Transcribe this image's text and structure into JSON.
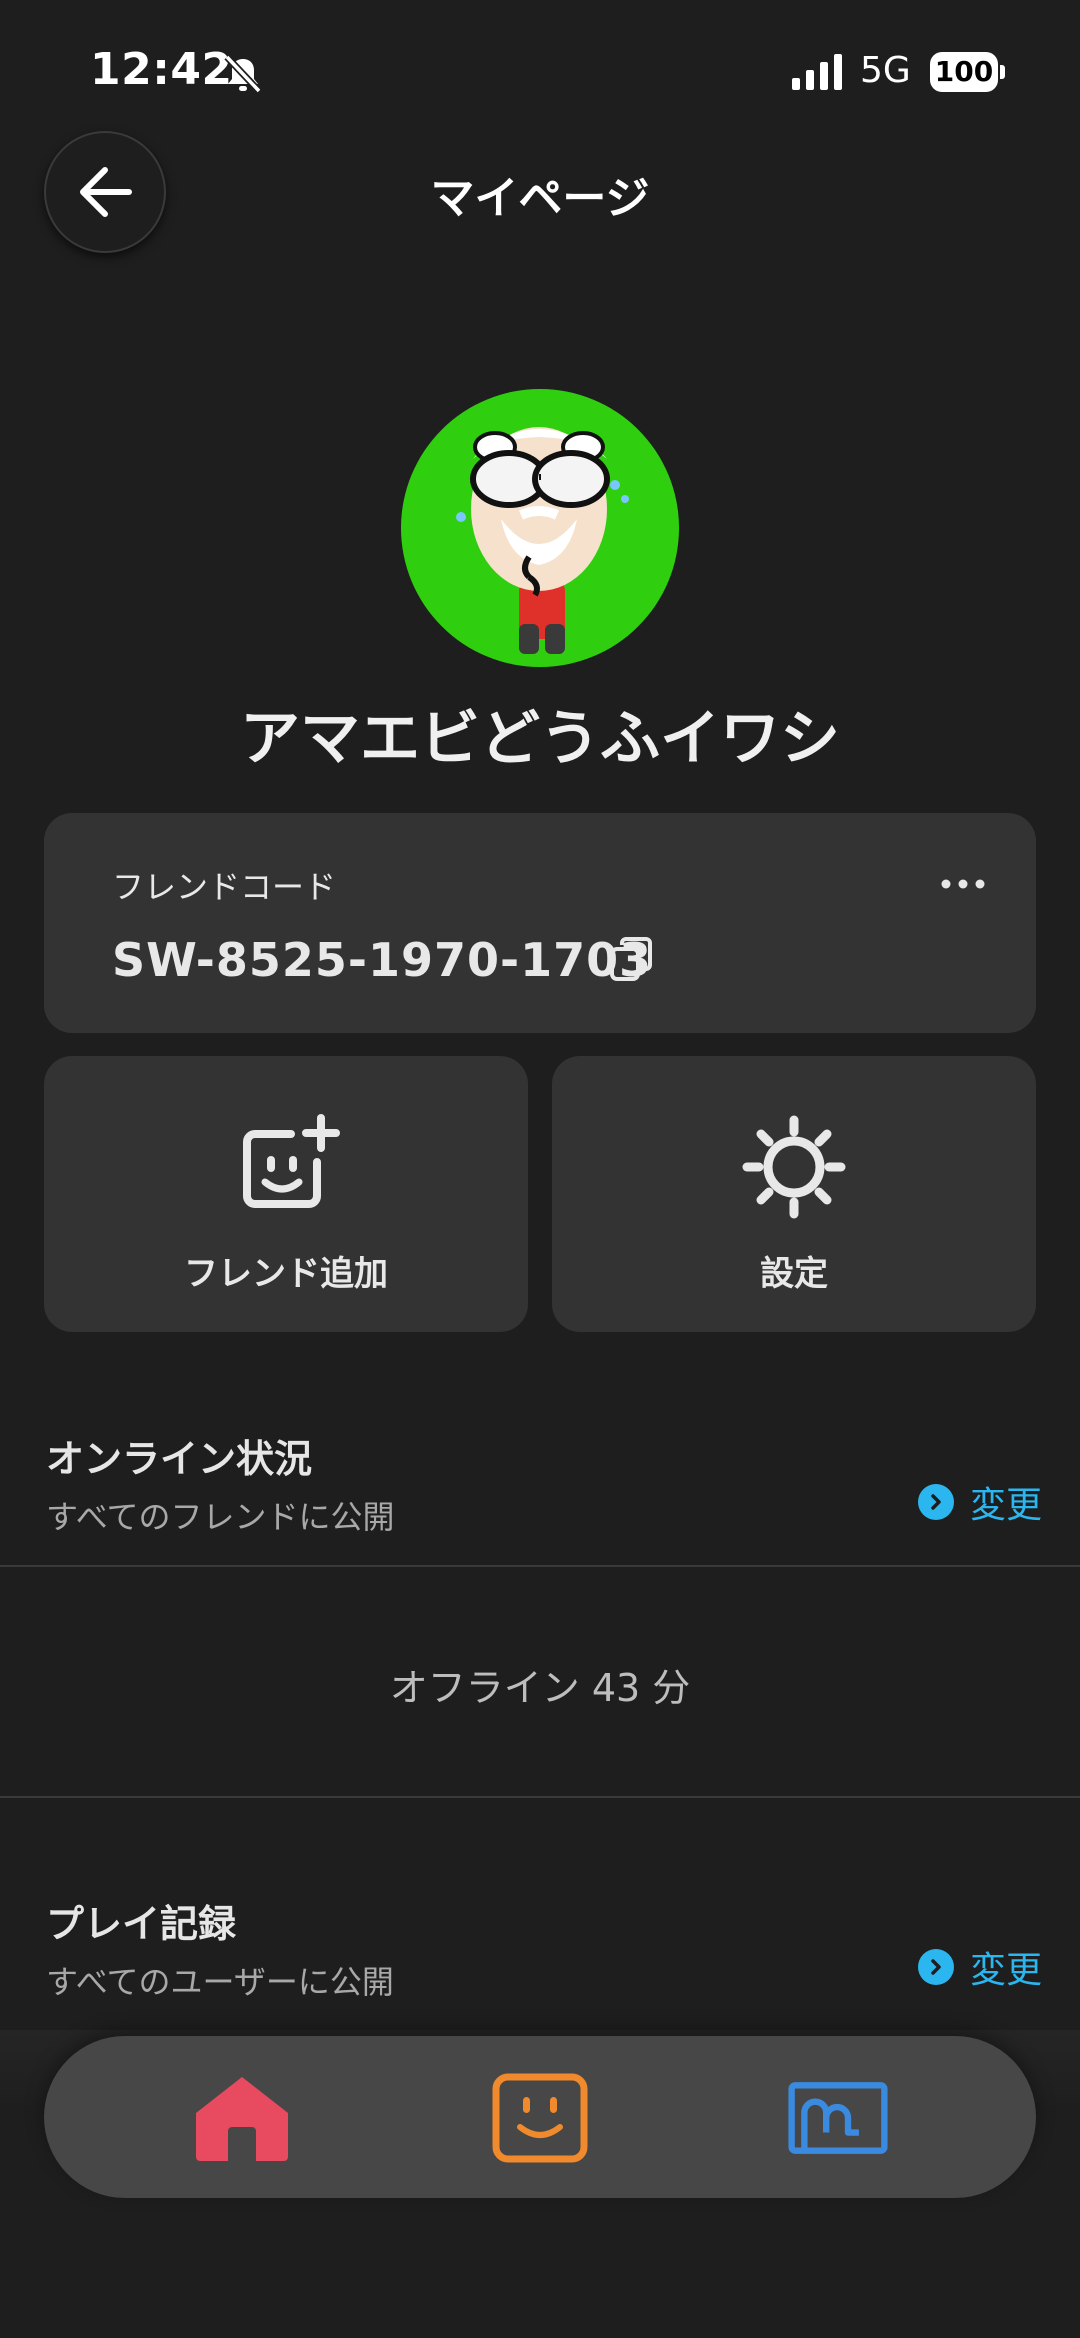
{
  "status_bar": {
    "time": "12:42",
    "network": "5G",
    "battery": "100"
  },
  "header": {
    "title": "マイページ"
  },
  "profile": {
    "username": "アマエビどうふイワシ"
  },
  "friend_code": {
    "label": "フレンドコード",
    "value": "SW-8525-1970-1703"
  },
  "actions": [
    {
      "label": "フレンド追加",
      "icon": "add-friend-icon"
    },
    {
      "label": "設定",
      "icon": "gear-icon"
    }
  ],
  "online_status": {
    "title": "オンライン状況",
    "subtitle": "すべてのフレンドに公開",
    "change_label": "変更",
    "offline_text": "オフライン 43 分"
  },
  "play_record": {
    "title": "プレイ記録",
    "subtitle": "すべてのユーザーに公開",
    "change_label": "変更"
  },
  "nav": [
    {
      "icon": "home-icon",
      "color": "#e84a5f"
    },
    {
      "icon": "friends-face-icon",
      "color": "#f08a2c"
    },
    {
      "icon": "album-icon",
      "color": "#3a8be0"
    }
  ]
}
